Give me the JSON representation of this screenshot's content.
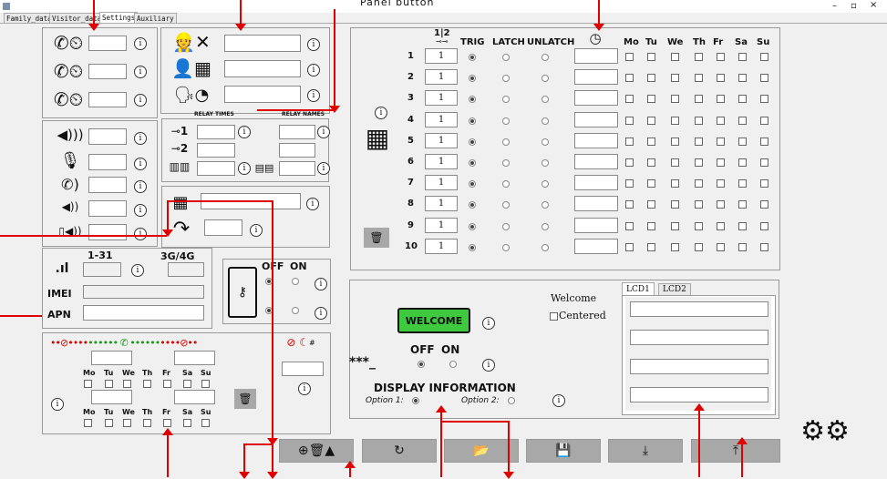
{
  "window": {
    "top_label": "Panel button"
  },
  "tabs": [
    {
      "label": "Family_data"
    },
    {
      "label": "Visitor_data"
    },
    {
      "label": "Settings"
    },
    {
      "label": "Auxiliary"
    }
  ],
  "relay": {
    "times_label": "RELAY TIMES",
    "names_label": "RELAY NAMES",
    "one": "1",
    "two": "2"
  },
  "signal": {
    "range_label": "1-31",
    "net_label": "3G/4G",
    "imei_label": "IMEI",
    "apn_label": "APN"
  },
  "door": {
    "off_label": "OFF",
    "on_label": "ON"
  },
  "schedule_bottom": {
    "days": [
      "Mo",
      "Tu",
      "We",
      "Th",
      "Fr",
      "Sa",
      "Su"
    ],
    "hash": "#"
  },
  "schedule": {
    "header_112": "1|2",
    "trig": "TRIG",
    "latch": "LATCH",
    "unlatch": "UNLATCH",
    "days": [
      "Mo",
      "Tu",
      "We",
      "Th",
      "Fr",
      "Sa",
      "Su"
    ],
    "rows": [
      {
        "n": "1",
        "v": "1"
      },
      {
        "n": "2",
        "v": "1"
      },
      {
        "n": "3",
        "v": "1"
      },
      {
        "n": "4",
        "v": "1"
      },
      {
        "n": "5",
        "v": "1"
      },
      {
        "n": "6",
        "v": "1"
      },
      {
        "n": "7",
        "v": "1"
      },
      {
        "n": "8",
        "v": "1"
      },
      {
        "n": "9",
        "v": "1"
      },
      {
        "n": "10",
        "v": "1"
      }
    ]
  },
  "display": {
    "welcome_btn": "WELCOME",
    "welcome_text": "Welcome",
    "centered": "Centered",
    "off": "OFF",
    "on": "ON",
    "stars": "***_",
    "title": "DISPLAY INFORMATION",
    "opt1": "Option 1:",
    "opt2": "Option 2:",
    "lcd1": "LCD1",
    "lcd2": "LCD2"
  },
  "colors": {
    "arrow": "#e00000",
    "welcome_green": "#3ec93e",
    "bottom_btn": "#a8a8a8"
  },
  "icons": {
    "gear": "gear-icon",
    "calendar": "calendar-icon",
    "trash": "trash-icon"
  }
}
